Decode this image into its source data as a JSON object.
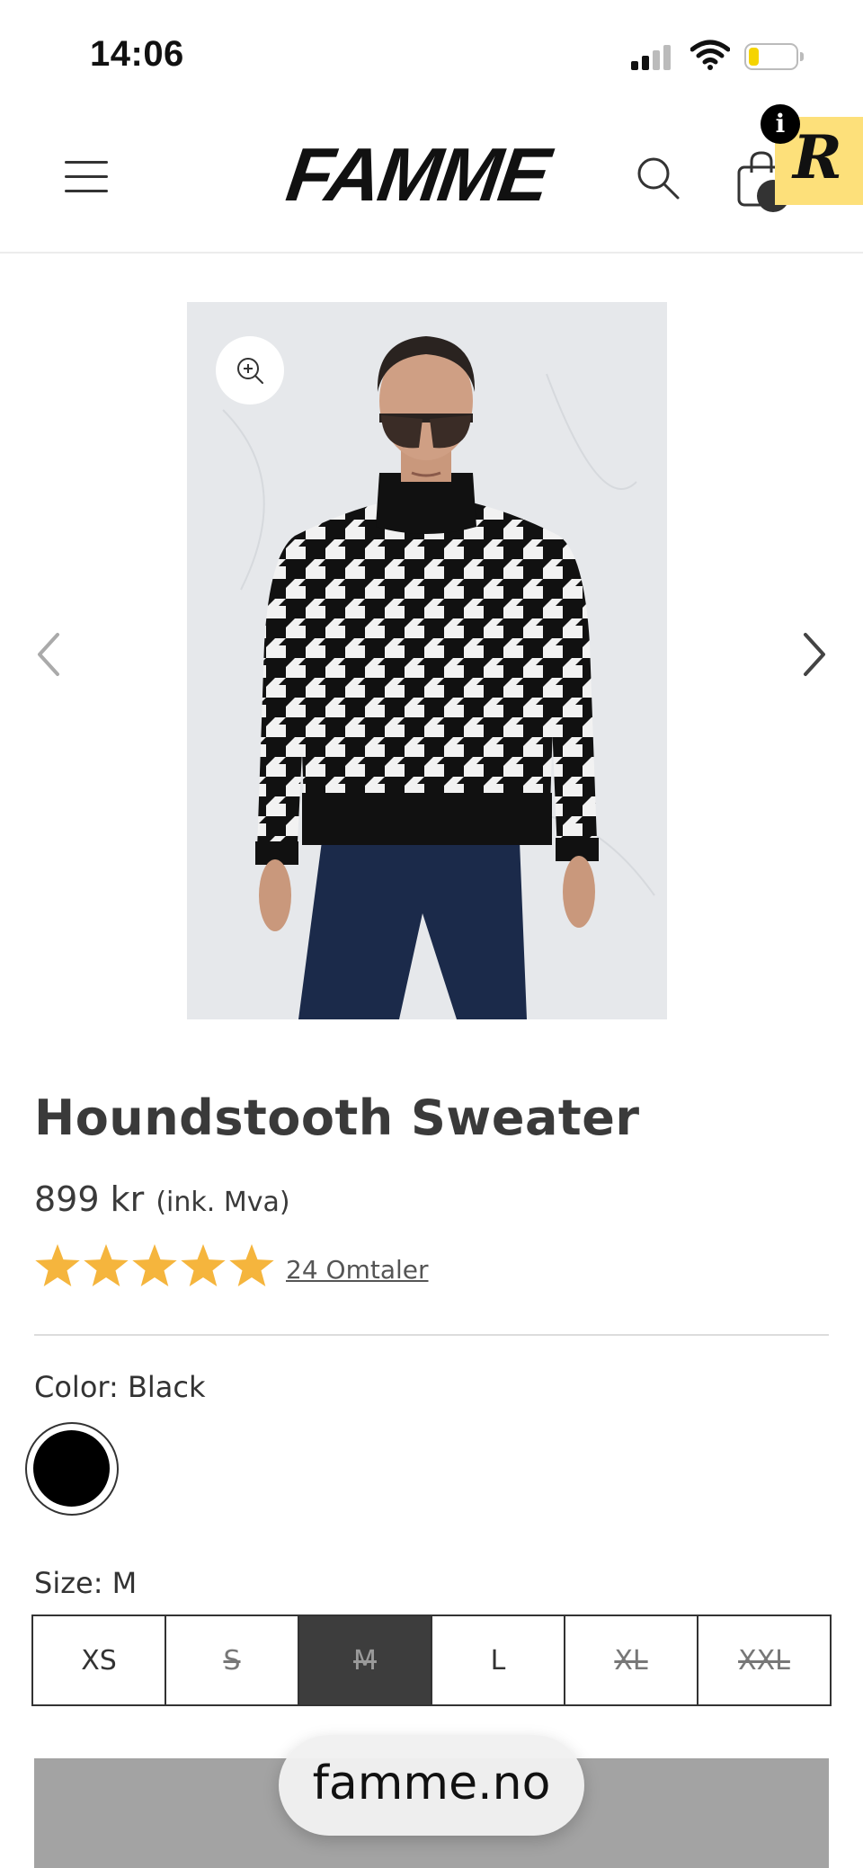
{
  "status_bar": {
    "time": "14:06",
    "battery_color": "#f5d400"
  },
  "header": {
    "logo": "FAMME",
    "menu_icon": "hamburger-menu-icon",
    "search_icon": "search-icon",
    "cart_icon": "shopping-bag-icon",
    "promo_badge_letter": "R",
    "promo_badge_color": "#fde07a",
    "info_icon_label": "i"
  },
  "gallery": {
    "zoom_icon": "zoom-in-icon",
    "prev_icon": "chevron-left-icon",
    "next_icon": "chevron-right-icon"
  },
  "product": {
    "title": "Houndstooth Sweater",
    "price": "899 kr",
    "price_note": "(ink. Mva)",
    "rating": 5,
    "reviews_link": "24 Omtaler",
    "star_color": "#f5b53d",
    "color_label": "Color: Black",
    "swatch_color": "#000000",
    "size_label": "Size: M",
    "sizes": [
      {
        "label": "XS",
        "available": true,
        "selected": false
      },
      {
        "label": "S",
        "available": false,
        "selected": false
      },
      {
        "label": "M",
        "available": false,
        "selected": true
      },
      {
        "label": "L",
        "available": true,
        "selected": false
      },
      {
        "label": "XL",
        "available": false,
        "selected": false
      },
      {
        "label": "XXL",
        "available": false,
        "selected": false
      }
    ]
  },
  "browser": {
    "url": "famme.no"
  }
}
